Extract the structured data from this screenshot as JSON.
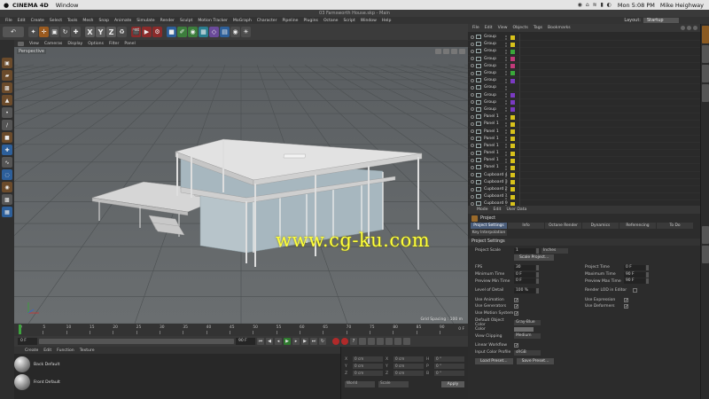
{
  "mac_menubar": {
    "apple": "",
    "app_name": "CINEMA 4D",
    "menu_window": "Window",
    "clock": "Mon 5:08 PM",
    "user": "Mike Heighway",
    "status_icons": "◉ ⌂ ≋ ▮ ◐"
  },
  "window_title": "03 Farnsworth House.skp - Main",
  "app_menu": {
    "items": [
      "File",
      "Edit",
      "Create",
      "Select",
      "Tools",
      "Mesh",
      "Snap",
      "Animate",
      "Simulate",
      "Render",
      "Sculpt",
      "Motion Tracker",
      "MoGraph",
      "Character",
      "Pipeline",
      "Plugins",
      "Octane",
      "Script",
      "Window",
      "Help"
    ],
    "layout_label": "Layout:",
    "layout_value": "Startup"
  },
  "toolbar": {
    "axis_x": "X",
    "axis_y": "Y",
    "axis_z": "Z"
  },
  "viewport": {
    "menu": [
      "View",
      "Cameras",
      "Display",
      "Options",
      "Filter",
      "Panel"
    ],
    "label": "Perspective",
    "grid_spacing": "Grid Spacing : 100 m",
    "watermark": "www.cg-ku.com"
  },
  "timeline": {
    "ticks": [
      "0",
      "5",
      "10",
      "15",
      "20",
      "25",
      "30",
      "35",
      "40",
      "45",
      "50",
      "55",
      "60",
      "65",
      "70",
      "75",
      "80",
      "85",
      "90"
    ],
    "end_frame": "0 F"
  },
  "transport": {
    "start_field": "0 F",
    "end_field": "90 F"
  },
  "material_manager": {
    "menu": [
      "Create",
      "Edit",
      "Function",
      "Texture"
    ],
    "materials": [
      {
        "name": "Back Default"
      },
      {
        "name": "Front Default"
      }
    ]
  },
  "coordinates": {
    "rows": [
      {
        "a": "X",
        "av": "0 cm",
        "b": "X",
        "bv": "0 cm",
        "c": "H",
        "cv": "0 °"
      },
      {
        "a": "Y",
        "av": "0 cm",
        "b": "Y",
        "bv": "0 cm",
        "c": "P",
        "cv": "0 °"
      },
      {
        "a": "Z",
        "av": "0 cm",
        "b": "Z",
        "bv": "0 cm",
        "c": "B",
        "cv": "0 °"
      }
    ],
    "world": "World",
    "scale": "Scale",
    "apply": "Apply"
  },
  "object_manager": {
    "menu": [
      "File",
      "Edit",
      "View",
      "Objects",
      "Tags",
      "Bookmarks"
    ],
    "objects": [
      {
        "name": "Group",
        "tag": "#d8c21a"
      },
      {
        "name": "Group",
        "tag": "#d8c21a"
      },
      {
        "name": "Group",
        "tag": "#3aa83a"
      },
      {
        "name": "Group",
        "tag": "#c23a7a"
      },
      {
        "name": "Group",
        "tag": "#c23a7a"
      },
      {
        "name": "Group",
        "tag": "#3aa83a"
      },
      {
        "name": "Group",
        "tag": "#7a3ac2"
      },
      {
        "name": "Group",
        "tag": ""
      },
      {
        "name": "Group",
        "tag": "#7a3ac2"
      },
      {
        "name": "Group",
        "tag": "#7a3ac2"
      },
      {
        "name": "Group",
        "tag": "#7a3ac2"
      },
      {
        "name": "Panel 1",
        "tag": "#d8c21a"
      },
      {
        "name": "Panel 1",
        "tag": "#d8c21a"
      },
      {
        "name": "Panel 1",
        "tag": "#d8c21a"
      },
      {
        "name": "Panel 1",
        "tag": "#d8c21a"
      },
      {
        "name": "Panel 1",
        "tag": "#d8c21a"
      },
      {
        "name": "Panel 1",
        "tag": "#d8c21a"
      },
      {
        "name": "Panel 1",
        "tag": "#d8c21a"
      },
      {
        "name": "Panel 1",
        "tag": "#d8c21a"
      },
      {
        "name": "Cupboard 4",
        "tag": "#d8c21a"
      },
      {
        "name": "Cupboard 3",
        "tag": "#d8c21a"
      },
      {
        "name": "Cupboard 2",
        "tag": "#d8c21a"
      },
      {
        "name": "Cupboard 1",
        "tag": "#d8c21a"
      },
      {
        "name": "Cupboard 0",
        "tag": "#d8c21a"
      }
    ]
  },
  "attribute_manager": {
    "menu": [
      "Mode",
      "Edit",
      "User Data"
    ],
    "title": "Project",
    "tabs": [
      "Project Settings",
      "Info",
      "Octane Render",
      "Dynamics",
      "Referencing",
      "To Do",
      "Key Interpolation"
    ],
    "section": "Project Settings",
    "project_scale_label": "Project Scale",
    "project_scale_value": "1",
    "project_scale_unit": "Inches",
    "scale_button": "Scale Project...",
    "fps_label": "FPS",
    "fps_value": "30",
    "project_time_label": "Project Time",
    "project_time_value": "0 F",
    "min_time_label": "Minimum Time",
    "min_time_value": "0 F",
    "max_time_label": "Maximum Time",
    "max_time_value": "90 F",
    "preview_min_label": "Preview Min Time",
    "preview_min_value": "0 F",
    "preview_max_label": "Preview Max Time",
    "preview_max_value": "90 F",
    "lod_label": "Level of Detail",
    "lod_value": "100 %",
    "render_lod_label": "Render LOD in Editor",
    "use_animation": "Use Animation",
    "use_expression": "Use Expression",
    "use_generators": "Use Generators",
    "use_deformers": "Use Deformers",
    "use_motion": "Use Motion System",
    "default_color_label": "Default Object Color",
    "default_color_value": "Gray-Blue",
    "color_label": "Color",
    "view_clipping_label": "View Clipping",
    "view_clipping_value": "Medium",
    "linear_workflow_label": "Linear Workflow",
    "input_profile_label": "Input Color Profile",
    "input_profile_value": "sRGB",
    "load_preset": "Load Preset...",
    "save_preset": "Save Preset...",
    "check": "✓"
  },
  "colors": {
    "viewport_bg": "#5f6366",
    "watermark": "#ffff3a",
    "accent_blue": "#4a5d7a"
  }
}
